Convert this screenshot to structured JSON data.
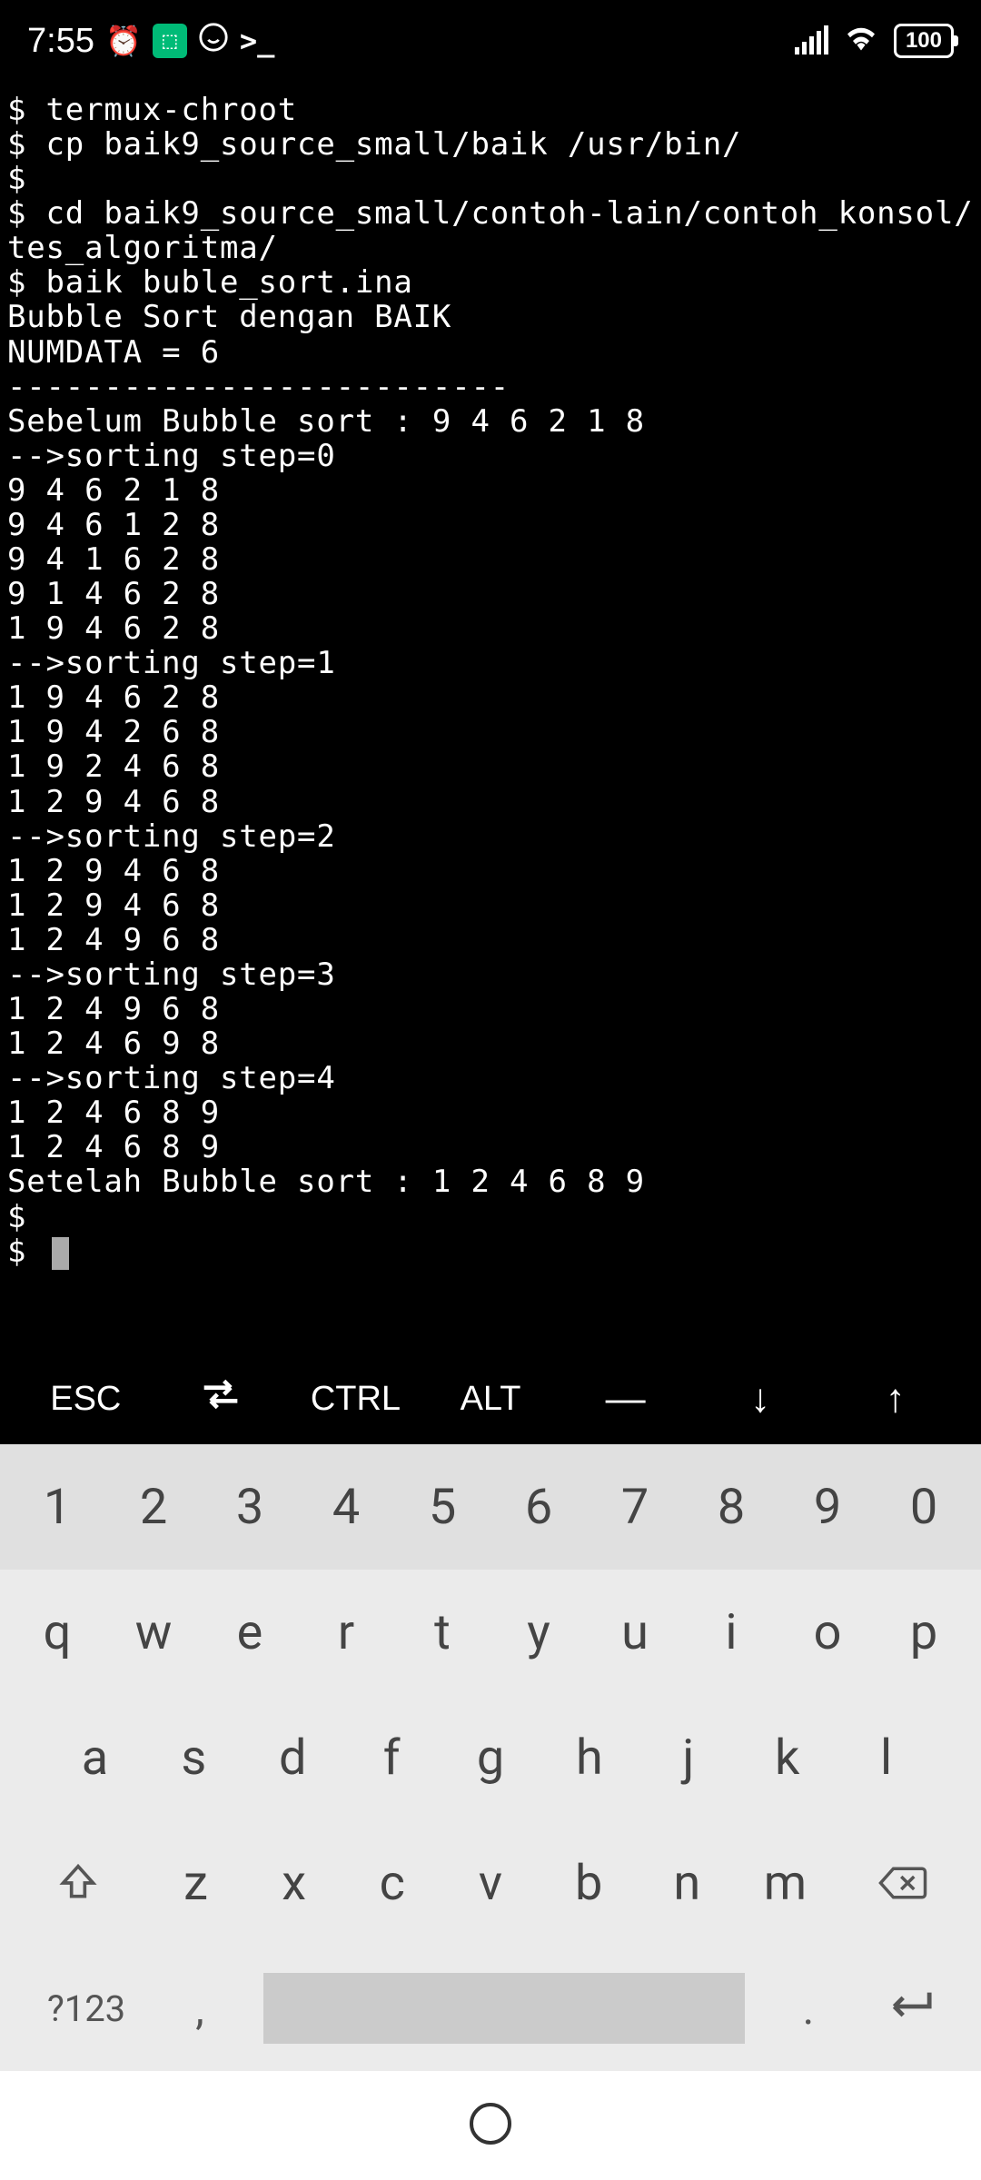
{
  "status": {
    "time": "7:55",
    "battery": "100"
  },
  "terminal": {
    "lines": [
      "$ termux-chroot",
      "$ cp baik9_source_small/baik /usr/bin/",
      "$",
      "$ cd baik9_source_small/contoh-lain/contoh_konsol/tes_algoritma/",
      "$ baik buble_sort.ina",
      "Bubble Sort dengan BAIK",
      "NUMDATA = 6",
      "--------------------------",
      "Sebelum Bubble sort : 9 4 6 2 1 8",
      "-->sorting step=0",
      "9 4 6 2 1 8",
      "9 4 6 1 2 8",
      "9 4 1 6 2 8",
      "9 1 4 6 2 8",
      "1 9 4 6 2 8",
      "-->sorting step=1",
      "1 9 4 6 2 8",
      "1 9 4 2 6 8",
      "1 9 2 4 6 8",
      "1 2 9 4 6 8",
      "-->sorting step=2",
      "1 2 9 4 6 8",
      "1 2 9 4 6 8",
      "1 2 4 9 6 8",
      "-->sorting step=3",
      "1 2 4 9 6 8",
      "1 2 4 6 9 8",
      "-->sorting step=4",
      "1 2 4 6 8 9",
      "1 2 4 6 8 9",
      "Setelah Bubble sort : 1 2 4 6 8 9",
      "$",
      "$ "
    ]
  },
  "extra_keys": {
    "esc": "ESC",
    "ctrl": "CTRL",
    "alt": "ALT",
    "dash": "—",
    "down": "↓",
    "up": "↑"
  },
  "keyboard": {
    "row1": [
      "1",
      "2",
      "3",
      "4",
      "5",
      "6",
      "7",
      "8",
      "9",
      "0"
    ],
    "row2": [
      "q",
      "w",
      "e",
      "r",
      "t",
      "y",
      "u",
      "i",
      "o",
      "p"
    ],
    "row3": [
      "a",
      "s",
      "d",
      "f",
      "g",
      "h",
      "j",
      "k",
      "l"
    ],
    "row4": [
      "z",
      "x",
      "c",
      "v",
      "b",
      "n",
      "m"
    ],
    "special": "?123",
    "comma": ",",
    "period": "."
  }
}
